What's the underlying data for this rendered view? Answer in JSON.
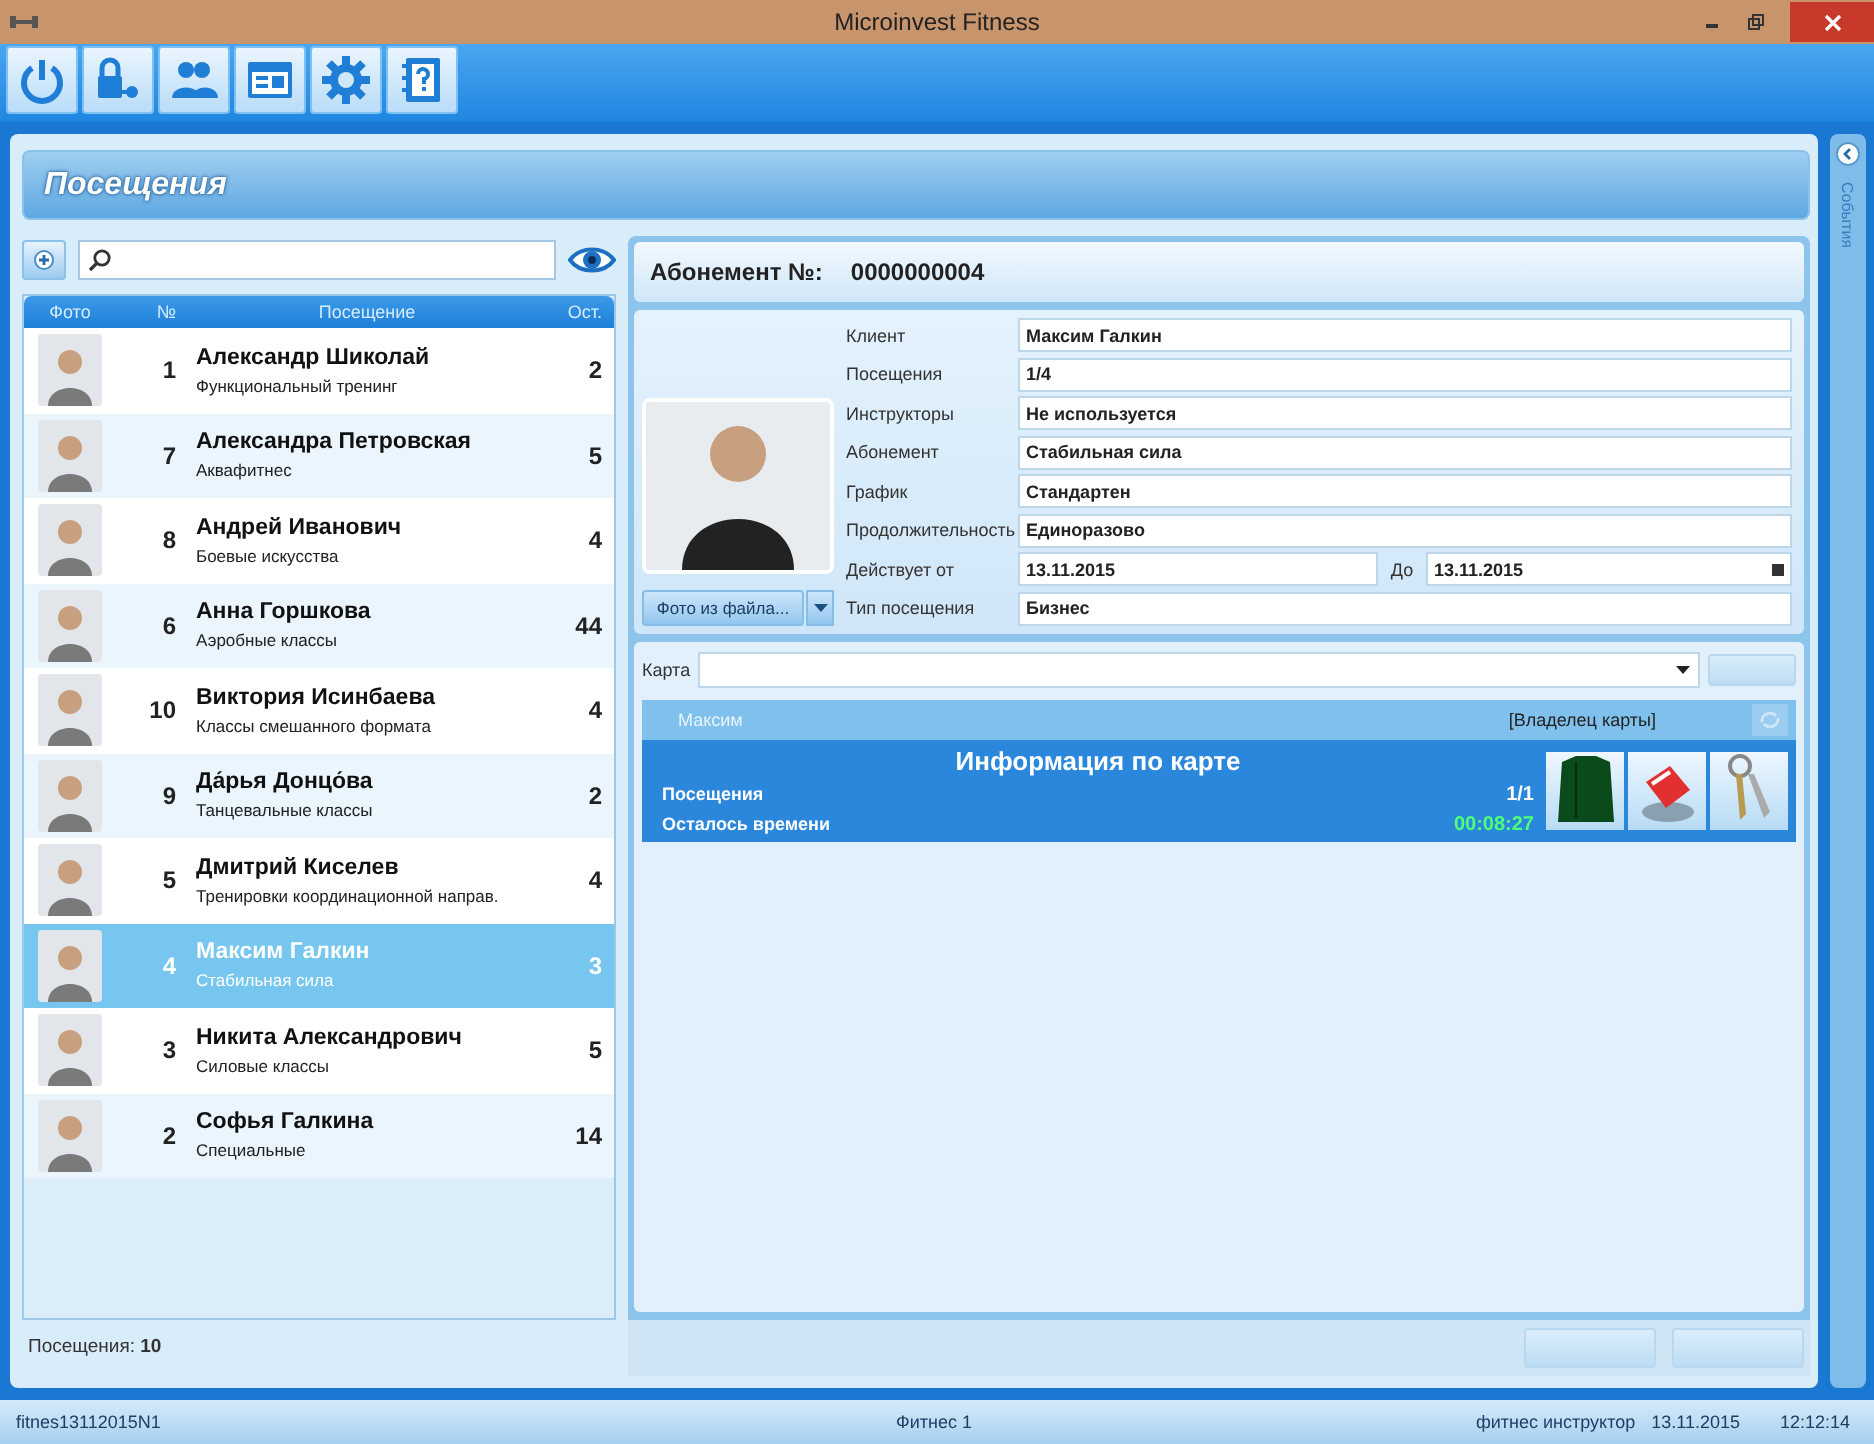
{
  "window": {
    "title": "Microinvest Fitness"
  },
  "page_title": "Посещения",
  "visits": {
    "columns": [
      "Фото",
      "№",
      "Посещение",
      "Ост."
    ],
    "rows": [
      {
        "number": "1",
        "name": "Александр Шиколай",
        "activity": "Функциональный тренинг",
        "remaining": "2",
        "selected": false
      },
      {
        "number": "7",
        "name": "Александра Петровская",
        "activity": "Аквафитнес",
        "remaining": "5",
        "selected": false
      },
      {
        "number": "8",
        "name": "Андрей Иванович",
        "activity": "Боевые искусства",
        "remaining": "4",
        "selected": false
      },
      {
        "number": "6",
        "name": "Анна Горшкова",
        "activity": "Аэробные классы",
        "remaining": "44",
        "selected": false
      },
      {
        "number": "10",
        "name": "Виктория Исинбаева",
        "activity": "Классы смешанного формата",
        "remaining": "4",
        "selected": false
      },
      {
        "number": "9",
        "name": "Да́рья Донцо́ва",
        "activity": "Танцевальные классы",
        "remaining": "2",
        "selected": false
      },
      {
        "number": "5",
        "name": "Дмитрий Киселев",
        "activity": "Тренировки координационной направ.",
        "remaining": "4",
        "selected": false
      },
      {
        "number": "4",
        "name": "Максим Галкин",
        "activity": "Стабильная сила",
        "remaining": "3",
        "selected": true
      },
      {
        "number": "3",
        "name": "Никита Александрович",
        "activity": "Силовые классы",
        "remaining": "5",
        "selected": false
      },
      {
        "number": "2",
        "name": "Софья Галкина",
        "activity": "Специальные",
        "remaining": "14",
        "selected": false
      }
    ],
    "footer": "Посещения: **10**"
  },
  "subscription": {
    "label": "Абонемент №:",
    "number": "0000000004",
    "photo_button": "Фото из файла...",
    "fields": [
      {
        "kind": "text",
        "label": "Клиент",
        "value": "Максим Галкин"
      },
      {
        "kind": "text",
        "label": "Посещения",
        "value": "1/4"
      },
      {
        "kind": "text",
        "label": "Инструкторы",
        "value": "Не используется"
      },
      {
        "kind": "text",
        "label": "Абонемент",
        "value": "Стабильная сила"
      },
      {
        "kind": "text",
        "label": "График",
        "value": "Стандартен"
      },
      {
        "kind": "text",
        "label": "Продолжительность",
        "value": "Единоразово"
      },
      {
        "kind": "date_range",
        "label": "Действует от",
        "value": "13.11.2015",
        "to_label": "До",
        "to_value": "13.11.2015"
      },
      {
        "kind": "text",
        "label": "Тип посещения",
        "value": "Бизнес"
      }
    ]
  },
  "card": {
    "label": "Карта",
    "owner_name": "Максим",
    "owner_label": "[Владелец карты]",
    "info_title": "Информация по карте",
    "rows": [
      {
        "kind": "count",
        "label": "Посещения",
        "value": "1/1"
      },
      {
        "kind": "timer",
        "label": "Осталось времени",
        "value": "00:08:27"
      }
    ]
  },
  "side_panel": {
    "label": "События"
  },
  "status_bar": {
    "session": "fitnes13112015N1",
    "location": "Фитнес 1",
    "user": "фитнес инструктор",
    "date": "13.11.2015",
    "time": "12:12:14"
  }
}
